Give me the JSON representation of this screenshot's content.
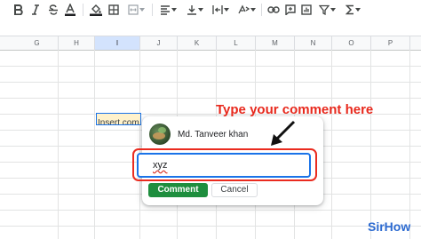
{
  "columns": [
    "G",
    "H",
    "I",
    "J",
    "K",
    "L",
    "M",
    "N",
    "O",
    "P"
  ],
  "active_column": "I",
  "cell": {
    "text": "Insert com"
  },
  "comment_popup": {
    "user_name": "Md. Tanveer khan",
    "input_value": "xyz",
    "comment_label": "Comment",
    "cancel_label": "Cancel"
  },
  "annotation": {
    "callout": "Type your comment here"
  },
  "logo": "SirHow",
  "colors": {
    "accent_blue": "#1a73e8",
    "comment_green": "#1e8e3e",
    "annotation_red": "#e8281c",
    "logo_blue": "#2d6bd1"
  },
  "toolbar_icons": [
    "bold-icon",
    "italic-icon",
    "strikethrough-icon",
    "text-color-icon",
    "fill-color-icon",
    "borders-icon",
    "merge-cells-icon",
    "horizontal-align-icon",
    "vertical-align-icon",
    "text-wrap-icon",
    "text-rotation-icon",
    "link-icon",
    "insert-comment-icon",
    "insert-chart-icon",
    "filter-icon",
    "functions-icon"
  ]
}
